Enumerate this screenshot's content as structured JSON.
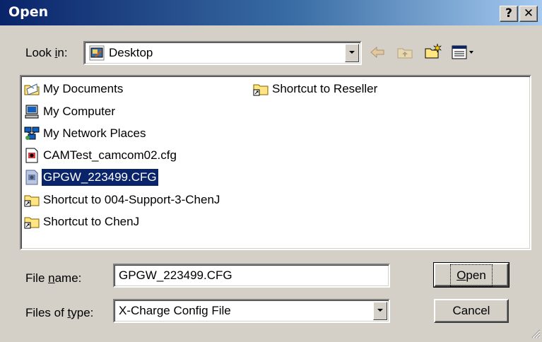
{
  "dialog": {
    "title": "Open",
    "help_button": "?",
    "close_button": "✕"
  },
  "look_in": {
    "label_pre": "Look ",
    "label_accel": "i",
    "label_post": "n:",
    "value": "Desktop"
  },
  "files": [
    {
      "name": "My Documents",
      "icon": "my-documents-icon"
    },
    {
      "name": "My Computer",
      "icon": "my-computer-icon"
    },
    {
      "name": "My Network Places",
      "icon": "network-places-icon"
    },
    {
      "name": "CAMTest_camcom02.cfg",
      "icon": "config-file-icon"
    },
    {
      "name": "GPGW_223499.CFG",
      "icon": "config-file-icon",
      "selected": true
    },
    {
      "name": "Shortcut to 004-Support-3-ChenJ",
      "icon": "folder-shortcut-icon"
    },
    {
      "name": "Shortcut to ChenJ",
      "icon": "folder-shortcut-icon"
    },
    {
      "name": "Shortcut to Reseller",
      "icon": "folder-shortcut-icon"
    }
  ],
  "file_name": {
    "label_pre": "File ",
    "label_accel": "n",
    "label_post": "ame:",
    "value": "GPGW_223499.CFG"
  },
  "files_of_type": {
    "label_pre": "Files of ",
    "label_accel": "t",
    "label_post": "ype:",
    "value": "X-Charge Config File"
  },
  "buttons": {
    "open_accel": "O",
    "open_rest": "pen",
    "cancel": "Cancel"
  },
  "colors": {
    "title_start": "#0a246a",
    "title_end": "#a6caf0",
    "selection": "#0a246a",
    "face": "#d4d0c8"
  }
}
